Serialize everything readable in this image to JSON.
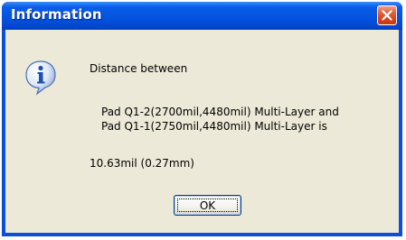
{
  "window": {
    "title": "Information",
    "close_icon": "close-icon"
  },
  "message": {
    "icon": "info-icon",
    "line1": "Distance between",
    "line2": "Pad Q1-2(2700mil,4480mil)  Multi-Layer and",
    "line3": "Pad Q1-1(2750mil,4480mil)  Multi-Layer is",
    "result": "10.63mil  (0.27mm)"
  },
  "buttons": {
    "ok_label": "OK"
  },
  "colors": {
    "titlebar": "#0454e0",
    "frame": "#0a4fd8",
    "client": "#ece9d8",
    "close": "#d8431c"
  }
}
